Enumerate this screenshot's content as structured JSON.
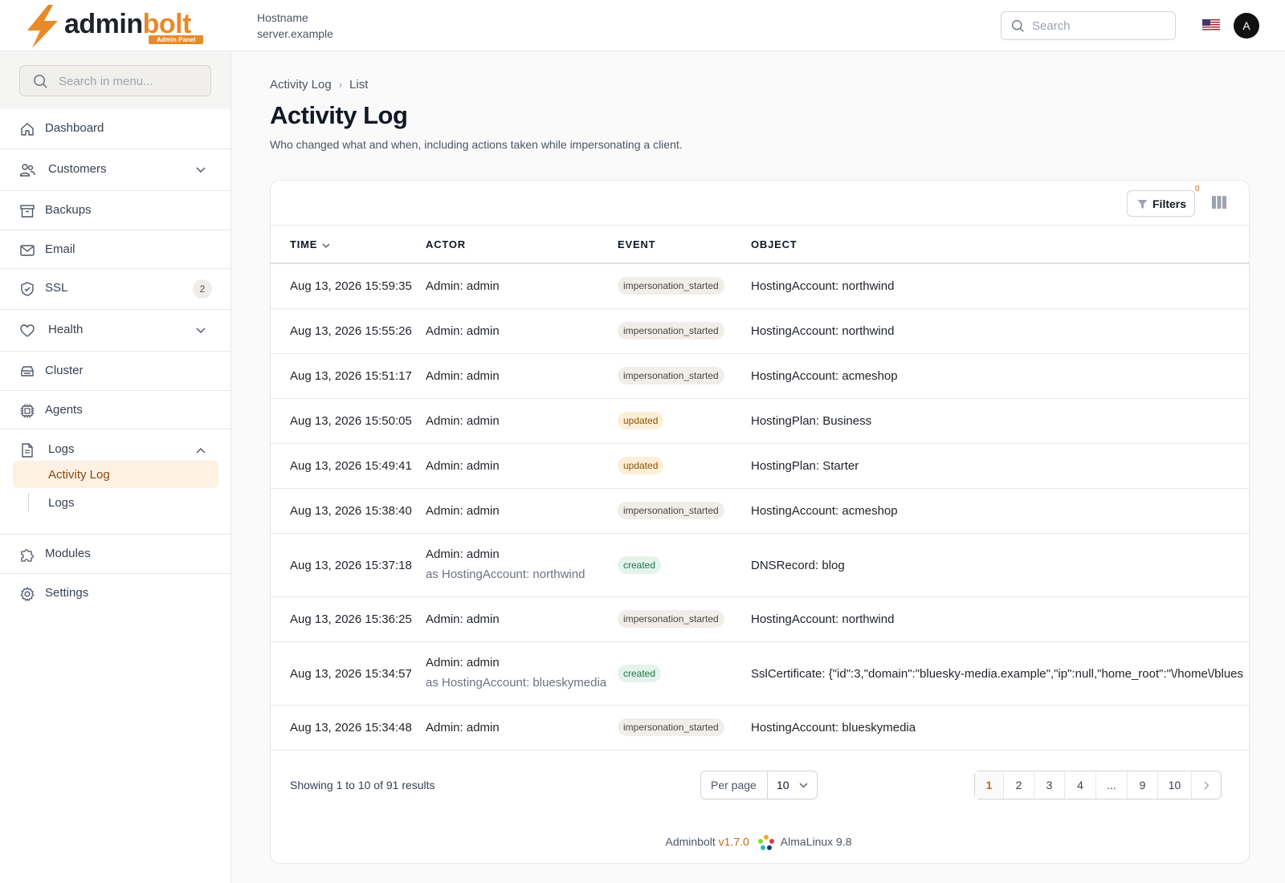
{
  "brand": {
    "word_a": "admin",
    "word_b": "bolt",
    "badge": "Admin Panel",
    "accent": "#e8892a"
  },
  "header": {
    "hostname_label": "Hostname",
    "hostname_value": "server.example",
    "search_placeholder": "Search",
    "flag_icon": "us-flag-icon",
    "avatar_initial": "A"
  },
  "sidebar": {
    "search_placeholder": "Search in menu...",
    "items": [
      {
        "label": "Dashboard",
        "icon": "home-icon"
      },
      {
        "label": "Customers",
        "icon": "users-icon"
      },
      {
        "label": "Backups",
        "icon": "archive-icon"
      },
      {
        "label": "Email",
        "icon": "mail-icon"
      },
      {
        "label": "SSL",
        "icon": "shield-icon",
        "badge": "2"
      },
      {
        "label": "Health",
        "icon": "heart-icon"
      },
      {
        "label": "Cluster",
        "icon": "server-icon"
      },
      {
        "label": "Agents",
        "icon": "cpu-icon"
      },
      {
        "label": "Logs",
        "icon": "file-icon"
      },
      {
        "label": "Modules",
        "icon": "puzzle-icon"
      },
      {
        "label": "Settings",
        "icon": "gear-icon"
      }
    ],
    "logs_sub": [
      {
        "label": "Activity Log",
        "active": true
      },
      {
        "label": "Logs",
        "active": false
      }
    ]
  },
  "page": {
    "breadcrumb": [
      "Activity Log",
      "List"
    ],
    "title": "Activity Log",
    "subtitle": "Who changed what and when, including actions taken while impersonating a client."
  },
  "table": {
    "filters_label": "Filters",
    "filters_count": "0",
    "columns": [
      "TIME",
      "ACTOR",
      "EVENT",
      "OBJECT"
    ],
    "rows": [
      {
        "time": "Aug 13, 2026 15:59:35",
        "actor": "Admin: admin",
        "as": "",
        "event": "impersonation_started",
        "object": "HostingAccount: northwind"
      },
      {
        "time": "Aug 13, 2026 15:55:26",
        "actor": "Admin: admin",
        "as": "",
        "event": "impersonation_started",
        "object": "HostingAccount: northwind"
      },
      {
        "time": "Aug 13, 2026 15:51:17",
        "actor": "Admin: admin",
        "as": "",
        "event": "impersonation_started",
        "object": "HostingAccount: acmeshop"
      },
      {
        "time": "Aug 13, 2026 15:50:05",
        "actor": "Admin: admin",
        "as": "",
        "event": "updated",
        "object": "HostingPlan: Business"
      },
      {
        "time": "Aug 13, 2026 15:49:41",
        "actor": "Admin: admin",
        "as": "",
        "event": "updated",
        "object": "HostingPlan: Starter"
      },
      {
        "time": "Aug 13, 2026 15:38:40",
        "actor": "Admin: admin",
        "as": "",
        "event": "impersonation_started",
        "object": "HostingAccount: acmeshop"
      },
      {
        "time": "Aug 13, 2026 15:37:18",
        "actor": "Admin: admin",
        "as": "as HostingAccount: northwind",
        "event": "created",
        "object": "DNSRecord: blog"
      },
      {
        "time": "Aug 13, 2026 15:36:25",
        "actor": "Admin: admin",
        "as": "",
        "event": "impersonation_started",
        "object": "HostingAccount: northwind"
      },
      {
        "time": "Aug 13, 2026 15:34:57",
        "actor": "Admin: admin",
        "as": "as HostingAccount: blueskymedia",
        "event": "created",
        "object": "SslCertificate: {\"id\":3,\"domain\":\"bluesky-media.example\",\"ip\":null,\"home_root\":\"\\/home\\/blues"
      },
      {
        "time": "Aug 13, 2026 15:34:48",
        "actor": "Admin: admin",
        "as": "",
        "event": "impersonation_started",
        "object": "HostingAccount: blueskymedia"
      }
    ],
    "results_text": "Showing 1 to 10 of 91 results",
    "per_page_label": "Per page",
    "per_page_value": "10",
    "pages": [
      "1",
      "2",
      "3",
      "4",
      "...",
      "9",
      "10"
    ],
    "current_page": "1"
  },
  "footer": {
    "name": "Adminbolt",
    "version": "v1.7.0",
    "os": "AlmaLinux 9.8"
  }
}
